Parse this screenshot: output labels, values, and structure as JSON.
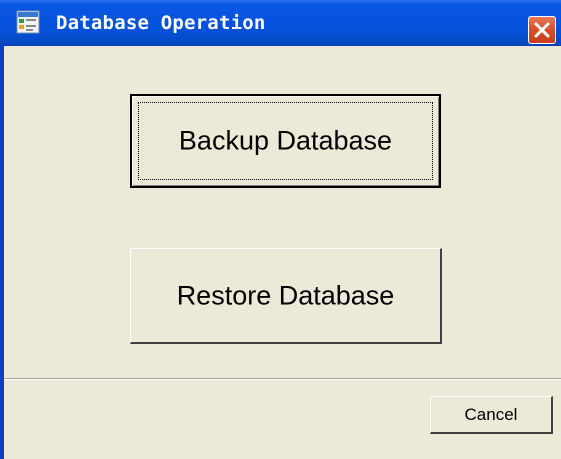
{
  "window": {
    "title": "Database Operation",
    "close_icon": "close-icon"
  },
  "buttons": {
    "backup_label": "Backup Database",
    "restore_label": "Restore Database",
    "cancel_label": "Cancel"
  },
  "colors": {
    "titlebar": "#0653de",
    "close_button": "#d9502e",
    "dialog_background": "#ece9d8"
  }
}
